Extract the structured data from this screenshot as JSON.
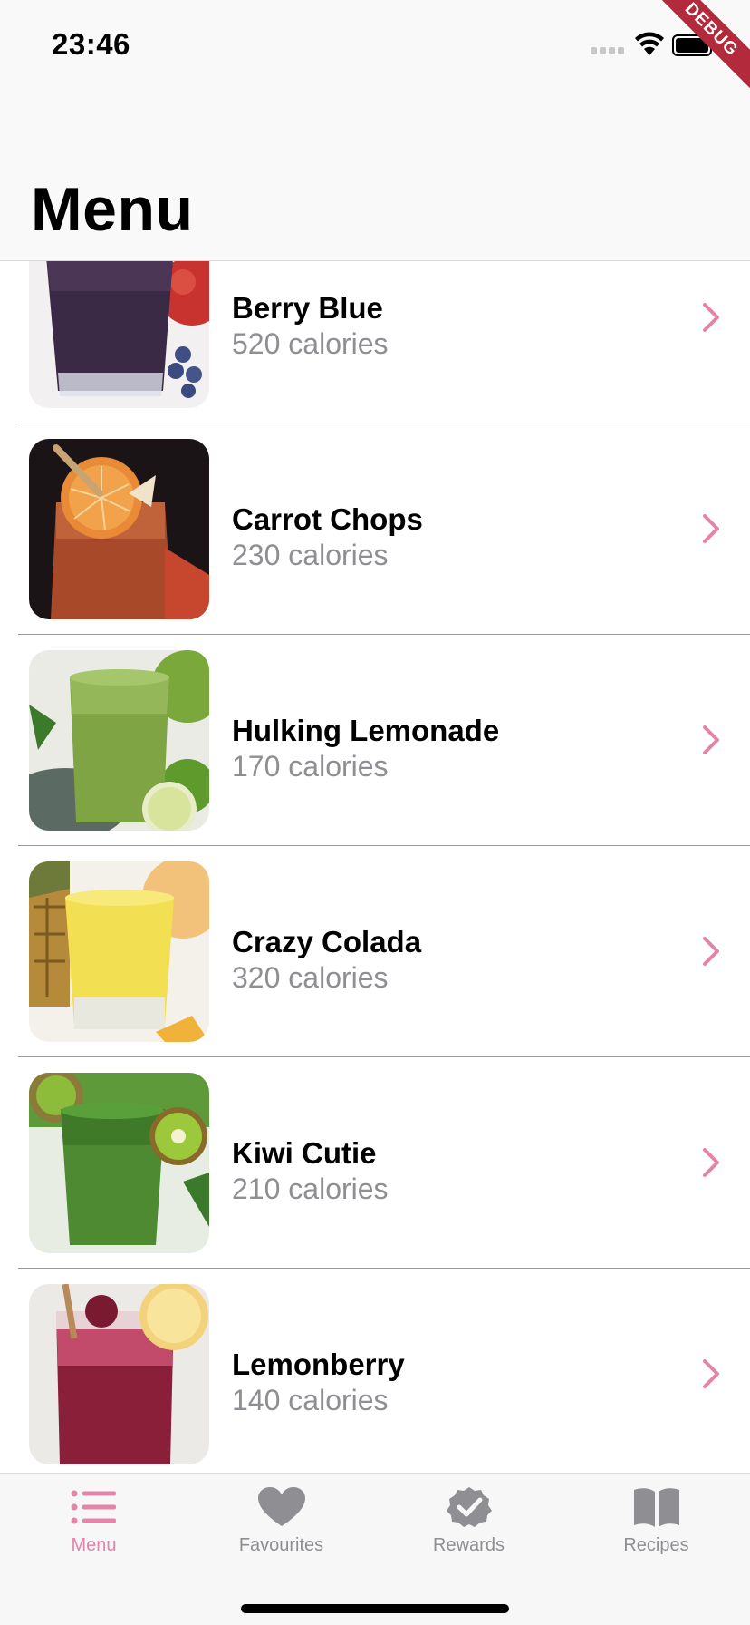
{
  "status_bar": {
    "time": "23:46"
  },
  "debug_banner": "DEBUG",
  "header": {
    "title": "Menu"
  },
  "colors": {
    "accent": "#e384a8",
    "secondary_text": "#8e8e93",
    "inactive_icon": "#8e8e93"
  },
  "items": [
    {
      "name": "Berry Blue",
      "calories": "520 calories",
      "icon": "chevron-right-icon"
    },
    {
      "name": "Carrot Chops",
      "calories": "230 calories",
      "icon": "chevron-right-icon"
    },
    {
      "name": "Hulking Lemonade",
      "calories": "170 calories",
      "icon": "chevron-right-icon"
    },
    {
      "name": "Crazy Colada",
      "calories": "320 calories",
      "icon": "chevron-right-icon"
    },
    {
      "name": "Kiwi Cutie",
      "calories": "210 calories",
      "icon": "chevron-right-icon"
    },
    {
      "name": "Lemonberry",
      "calories": "140 calories",
      "icon": "chevron-right-icon"
    }
  ],
  "tabs": [
    {
      "label": "Menu",
      "icon": "list-icon",
      "active": true
    },
    {
      "label": "Favourites",
      "icon": "heart-icon",
      "active": false
    },
    {
      "label": "Rewards",
      "icon": "badge-check-icon",
      "active": false
    },
    {
      "label": "Recipes",
      "icon": "book-icon",
      "active": false
    }
  ]
}
